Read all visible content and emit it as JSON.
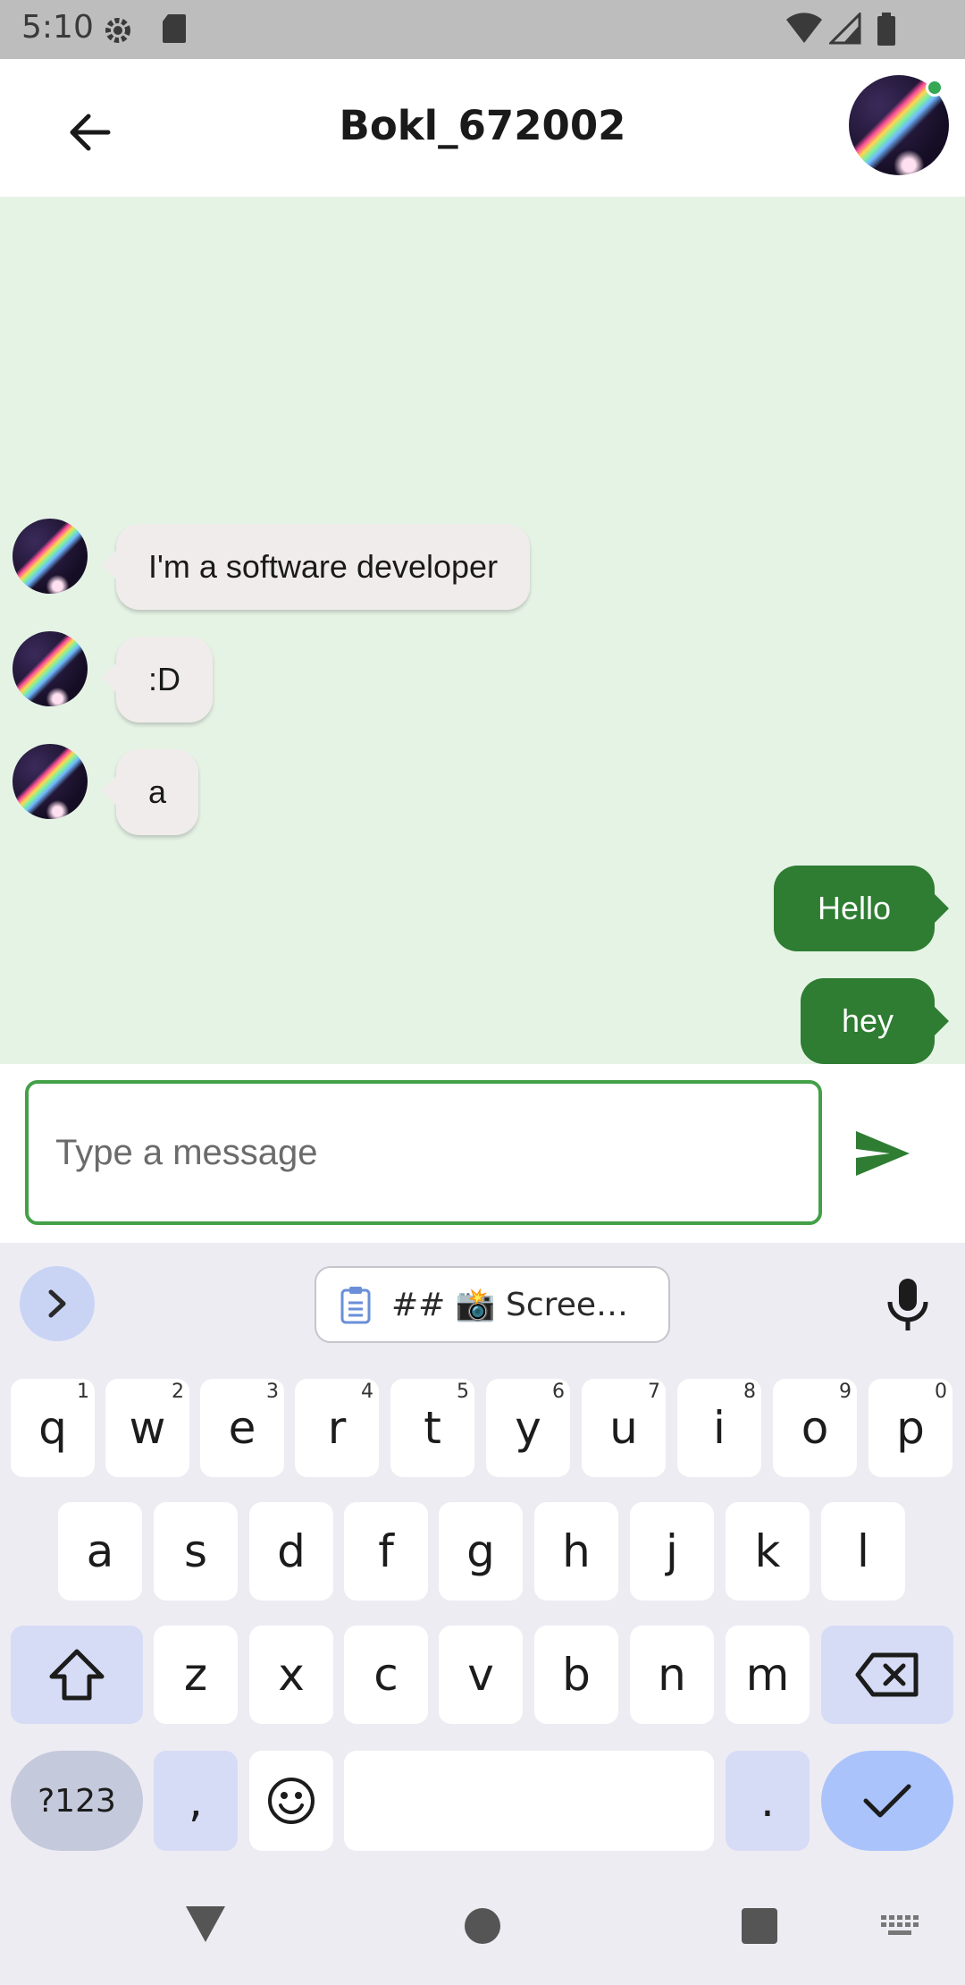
{
  "status_bar": {
    "time": "5:10"
  },
  "header": {
    "title": "Bokl_672002"
  },
  "messages": [
    {
      "direction": "in",
      "text": "I'm a software developer"
    },
    {
      "direction": "in",
      "text": ":D"
    },
    {
      "direction": "in",
      "text": "a"
    },
    {
      "direction": "out",
      "text": "Hello"
    },
    {
      "direction": "out",
      "text": "hey"
    }
  ],
  "composer": {
    "placeholder": "Type a message"
  },
  "keyboard": {
    "clipboard_chip": "## 📸 Scree…",
    "row1": [
      {
        "k": "q",
        "h": "1"
      },
      {
        "k": "w",
        "h": "2"
      },
      {
        "k": "e",
        "h": "3"
      },
      {
        "k": "r",
        "h": "4"
      },
      {
        "k": "t",
        "h": "5"
      },
      {
        "k": "y",
        "h": "6"
      },
      {
        "k": "u",
        "h": "7"
      },
      {
        "k": "i",
        "h": "8"
      },
      {
        "k": "o",
        "h": "9"
      },
      {
        "k": "p",
        "h": "0"
      }
    ],
    "row2": [
      "a",
      "s",
      "d",
      "f",
      "g",
      "h",
      "j",
      "k",
      "l"
    ],
    "row3": [
      "z",
      "x",
      "c",
      "v",
      "b",
      "n",
      "m"
    ],
    "symbols_label": "?123",
    "comma": ",",
    "period": "."
  },
  "colors": {
    "accent_green": "#2e7d32",
    "chat_background": "#e5f3e5",
    "incoming_bubble": "#f1ecec",
    "online_indicator": "#34a853"
  }
}
